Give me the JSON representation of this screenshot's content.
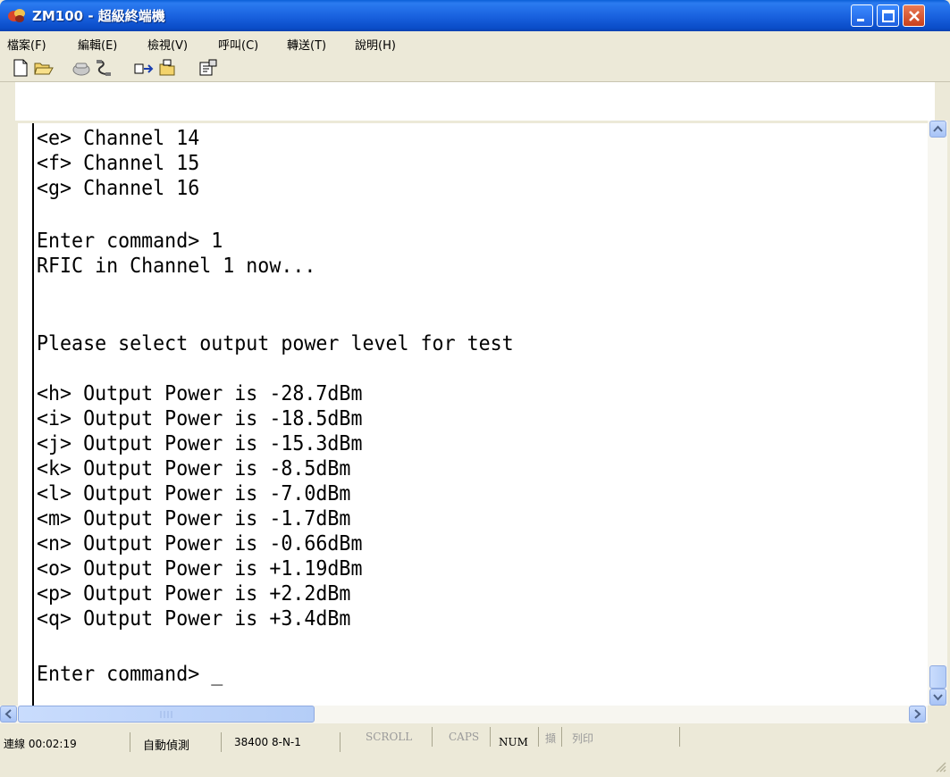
{
  "window": {
    "title": "ZM100 - 超級終端機"
  },
  "menu": [
    "檔案(F)",
    "編輯(E)",
    "檢視(V)",
    "呼叫(C)",
    "轉送(T)",
    "說明(H)"
  ],
  "toolbar": {
    "icons": [
      "new-icon",
      "open-icon",
      "disconnect-icon",
      "call-icon",
      "send-icon",
      "receive-icon",
      "properties-icon"
    ]
  },
  "terminal": {
    "lines": [
      "<e> Channel 14",
      "<f> Channel 15",
      "<g> Channel 16",
      "",
      "Enter command> 1",
      "RFIC in Channel 1 now...",
      "",
      "",
      "Please select output power level for test",
      "",
      "<h> Output Power is -28.7dBm",
      "<i> Output Power is -18.5dBm",
      "<j> Output Power is -15.3dBm",
      "<k> Output Power is -8.5dBm",
      "<l> Output Power is -7.0dBm",
      "<m> Output Power is -1.7dBm",
      "<n> Output Power is -0.66dBm",
      "<o> Output Power is +1.19dBm",
      "<p> Output Power is +2.2dBm",
      "<q> Output Power is +3.4dBm",
      "",
      "Enter command> _"
    ]
  },
  "status": {
    "connection": "連線 00:02:19",
    "detect": "自動偵測",
    "settings": "38400 8-N-1",
    "scroll": "SCROLL",
    "caps": "CAPS",
    "num": "NUM",
    "capture": "擷",
    "print": "列印"
  },
  "colors": {
    "titlebar": "#0A4CC8",
    "close_button": "#C8401C",
    "chrome": "#ECE9D8"
  }
}
